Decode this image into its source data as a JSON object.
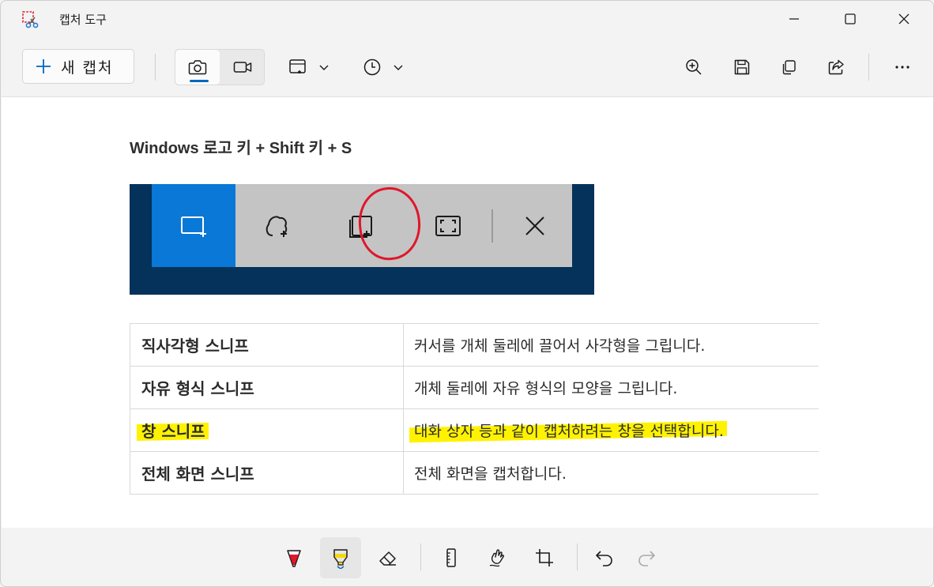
{
  "window": {
    "title": "캡처 도구"
  },
  "toolbar": {
    "new_capture_label": "새 캡처"
  },
  "content": {
    "heading": "Windows 로고 키 + Shift 키 + S",
    "table": [
      {
        "name": "직사각형 스니프",
        "desc": "커서를 개체 둘레에 끌어서 사각형을 그립니다."
      },
      {
        "name": "자유 형식 스니프",
        "desc": "개체 둘레에 자유 형식의 모양을 그립니다."
      },
      {
        "name": "창 스니프",
        "desc": "대화 상자 등과 같이 캡처하려는 창을 선택합니다."
      },
      {
        "name": "전체 화면 스니프",
        "desc": "전체 화면을 캡처합니다."
      }
    ]
  },
  "colors": {
    "accent": "#0067c0",
    "snip_selected": "#0a78d7",
    "highlight": "#fff200",
    "annotation_red": "#e0162b",
    "pen_red": "#e0162b",
    "highlighter_yellow": "#f5d90a"
  },
  "icons": {
    "titlebar": [
      "snipping-tool-app-icon",
      "minimize-icon",
      "maximize-icon",
      "close-icon"
    ],
    "toolbar": [
      "plus-icon",
      "camera-icon",
      "video-icon",
      "snip-mode-icon",
      "chevron-down-icon",
      "timer-icon",
      "chevron-down-icon",
      "zoom-in-icon",
      "save-icon",
      "copy-icon",
      "share-icon",
      "more-icon"
    ],
    "ink": [
      "ballpoint-pen-icon",
      "highlighter-icon",
      "eraser-icon",
      "ruler-icon",
      "touch-writing-icon",
      "crop-icon",
      "undo-icon",
      "redo-icon"
    ]
  }
}
